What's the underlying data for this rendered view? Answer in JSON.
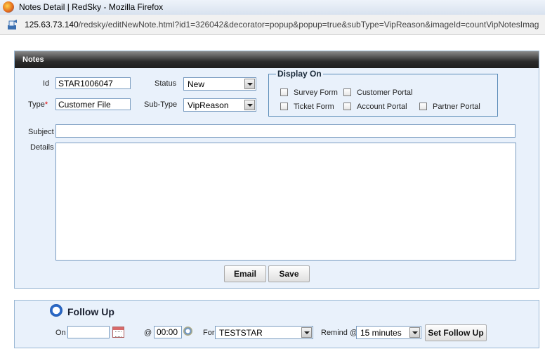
{
  "window": {
    "title": "Notes Detail | RedSky - Mozilla Firefox"
  },
  "address": {
    "host": "125.63.73.140",
    "path": "/redsky/editNewNote.html?id1=326042&decorator=popup&popup=true&subType=VipReason&imageId=countVipNotesImag"
  },
  "notes": {
    "header": "Notes",
    "id_label": "Id",
    "id_value": "STAR1006047",
    "type_label": "Type",
    "type_required": "*",
    "type_value": "Customer File",
    "status_label": "Status",
    "status_value": "New",
    "subtype_label": "Sub-Type",
    "subtype_value": "VipReason",
    "display_on": {
      "legend": "Display On",
      "options": [
        {
          "label": "Survey Form",
          "checked": false
        },
        {
          "label": "Customer Portal",
          "checked": false
        },
        {
          "label": "Ticket Form",
          "checked": false
        },
        {
          "label": "Account Portal",
          "checked": false
        },
        {
          "label": "Partner Portal",
          "checked": false
        }
      ]
    },
    "subject_label": "Subject",
    "subject_value": "",
    "details_label": "Details",
    "details_value": "",
    "email_button": "Email",
    "save_button": "Save"
  },
  "follow_up": {
    "title": "Follow Up",
    "on_label": "On",
    "on_value": "",
    "at_label": "@",
    "time_value": "00:00",
    "for_label": "For",
    "for_value": "TESTSTAR",
    "remind_label": "Remind @",
    "remind_value": "15 minutes",
    "set_button": "Set Follow Up"
  },
  "icons": {
    "browser": "firefox-icon",
    "site": "site-identity-icon",
    "clock": "alarm-clock-icon",
    "calendar": "calendar-icon",
    "time_picker": "clock-icon"
  }
}
